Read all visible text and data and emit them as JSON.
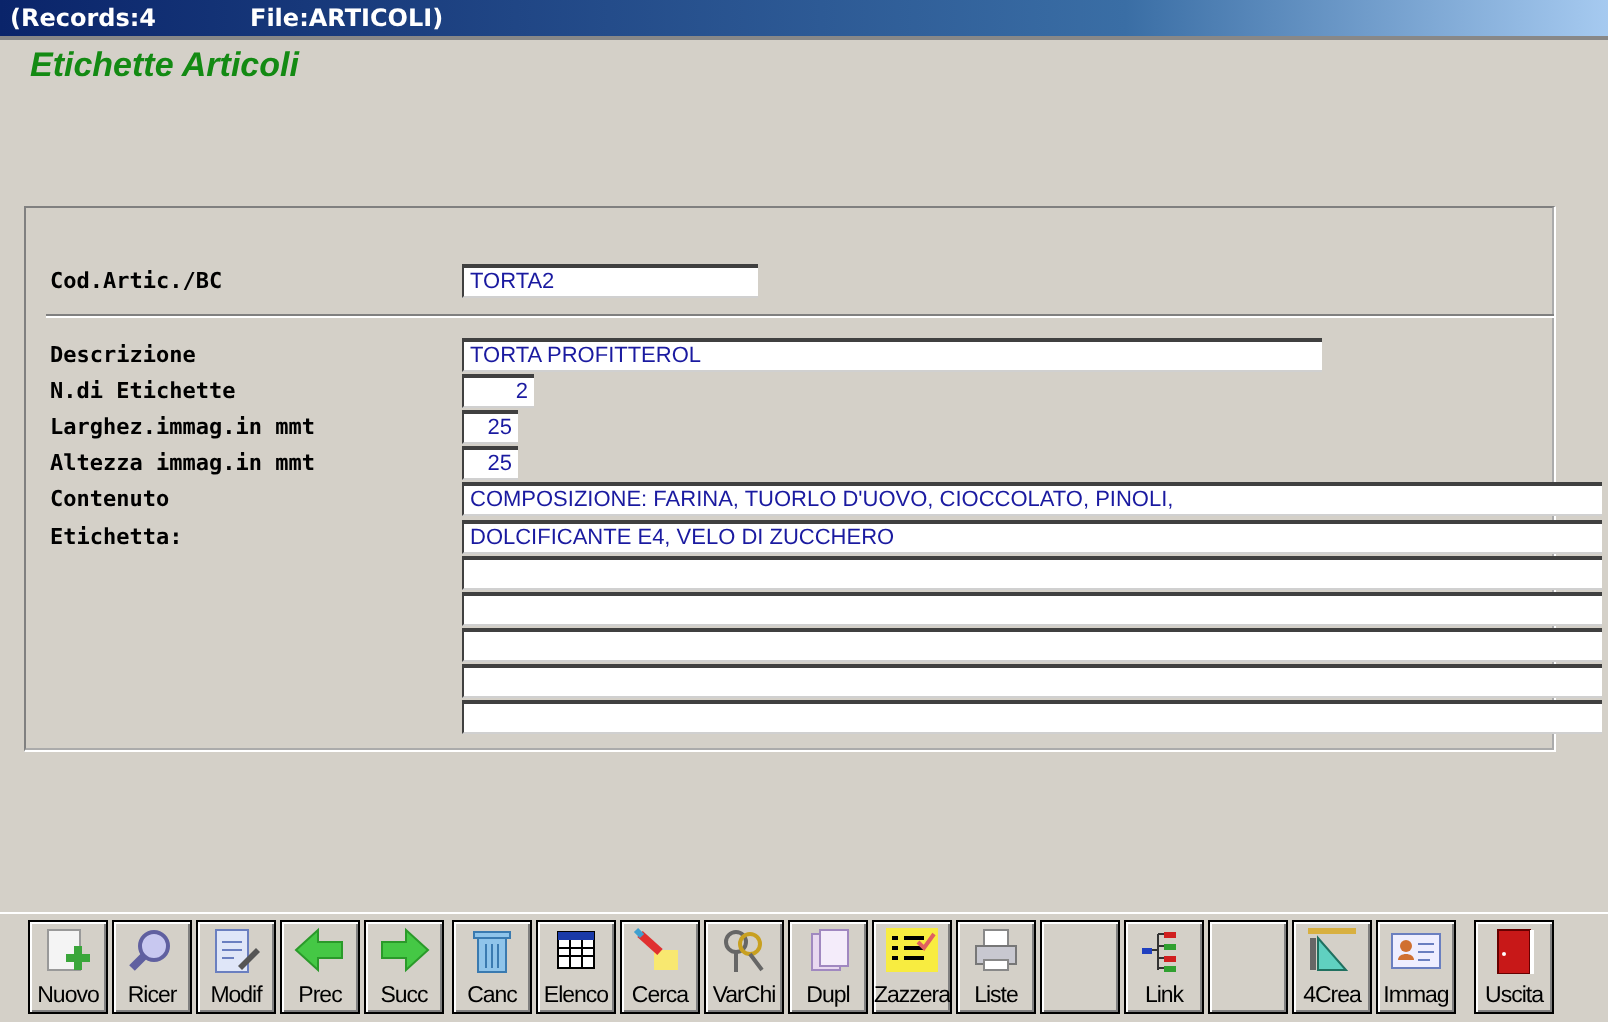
{
  "window": {
    "title_records": "(Records:4",
    "title_file": "File:ARTICOLI)"
  },
  "heading": "Etichette Articoli",
  "code_field": {
    "label": "Cod.Artic./BC",
    "value": "TORTA2"
  },
  "fields": [
    {
      "kind": "text",
      "label": "Descrizione",
      "value": "TORTA PROFITTEROL"
    },
    {
      "kind": "count",
      "label": "N.di Etichette",
      "value": "2"
    },
    {
      "kind": "size",
      "label": "Larghez.immag.in mmt",
      "value": "25"
    },
    {
      "kind": "size",
      "label": "Altezza immag.in mmt",
      "value": "25"
    },
    {
      "kind": "memo",
      "label": "Contenuto",
      "value": "COMPOSIZIONE: FARINA, TUORLO D'UOVO, CIOCCOLATO, PINOLI,"
    },
    {
      "kind": "memo",
      "label": "Etichetta:",
      "value": "DOLCIFICANTE E4, VELO DI ZUCCHERO"
    },
    {
      "kind": "memo-line"
    },
    {
      "kind": "memo-line"
    },
    {
      "kind": "memo-line"
    },
    {
      "kind": "memo-line"
    },
    {
      "kind": "memo-line"
    }
  ],
  "toolbar": [
    {
      "kind": "button",
      "label": "Nuovo"
    },
    {
      "kind": "button",
      "label": "Ricer"
    },
    {
      "kind": "button",
      "label": "Modif"
    },
    {
      "kind": "button",
      "label": "Prec"
    },
    {
      "kind": "button",
      "label": "Succ"
    },
    {
      "kind": "button",
      "label": "Canc"
    },
    {
      "kind": "button",
      "label": "Elenco"
    },
    {
      "kind": "button",
      "label": "Cerca"
    },
    {
      "kind": "button",
      "label": "VarChi"
    },
    {
      "kind": "button",
      "label": "Dupl"
    },
    {
      "kind": "button",
      "label": "Zazzera"
    },
    {
      "kind": "button",
      "label": "Liste"
    },
    {
      "kind": "blank"
    },
    {
      "kind": "button",
      "label": "Link"
    },
    {
      "kind": "blank"
    },
    {
      "kind": "button",
      "label": "4Crea"
    },
    {
      "kind": "button",
      "label": "Immag"
    },
    {
      "kind": "exit",
      "label": "Uscita"
    }
  ]
}
